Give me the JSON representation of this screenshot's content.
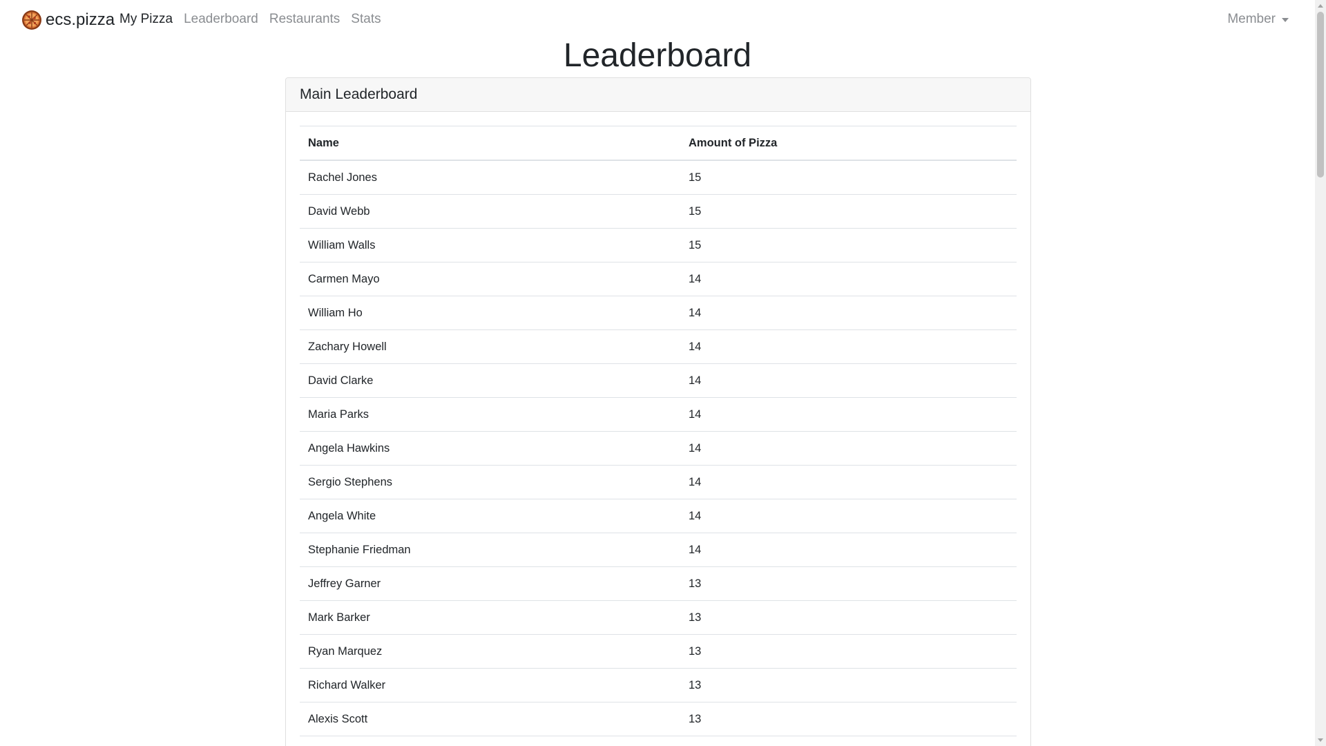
{
  "navbar": {
    "brand": "ecs.pizza",
    "brand_icon": "pizza-logo-icon",
    "links": [
      {
        "label": "My Pizza",
        "active": true
      },
      {
        "label": "Leaderboard",
        "active": false
      },
      {
        "label": "Restaurants",
        "active": false
      },
      {
        "label": "Stats",
        "active": false
      }
    ],
    "member_menu": "Member"
  },
  "page": {
    "title": "Leaderboard"
  },
  "card": {
    "header": "Main Leaderboard",
    "columns": [
      "Name",
      "Amount of Pizza"
    ],
    "rows": [
      {
        "name": "Rachel Jones",
        "amount": "15"
      },
      {
        "name": "David Webb",
        "amount": "15"
      },
      {
        "name": "William Walls",
        "amount": "15"
      },
      {
        "name": "Carmen Mayo",
        "amount": "14"
      },
      {
        "name": "William Ho",
        "amount": "14"
      },
      {
        "name": "Zachary Howell",
        "amount": "14"
      },
      {
        "name": "David Clarke",
        "amount": "14"
      },
      {
        "name": "Maria Parks",
        "amount": "14"
      },
      {
        "name": "Angela Hawkins",
        "amount": "14"
      },
      {
        "name": "Sergio Stephens",
        "amount": "14"
      },
      {
        "name": "Angela White",
        "amount": "14"
      },
      {
        "name": "Stephanie Friedman",
        "amount": "14"
      },
      {
        "name": "Jeffrey Garner",
        "amount": "13"
      },
      {
        "name": "Mark Barker",
        "amount": "13"
      },
      {
        "name": "Ryan Marquez",
        "amount": "13"
      },
      {
        "name": "Richard Walker",
        "amount": "13"
      },
      {
        "name": "Alexis Scott",
        "amount": "13"
      }
    ]
  },
  "colors": {
    "text": "#212529",
    "muted_nav": "#8a8d91",
    "card_header_bg": "#f7f7f7",
    "border": "#dee2e6",
    "logo_orange": "#d9652b"
  }
}
